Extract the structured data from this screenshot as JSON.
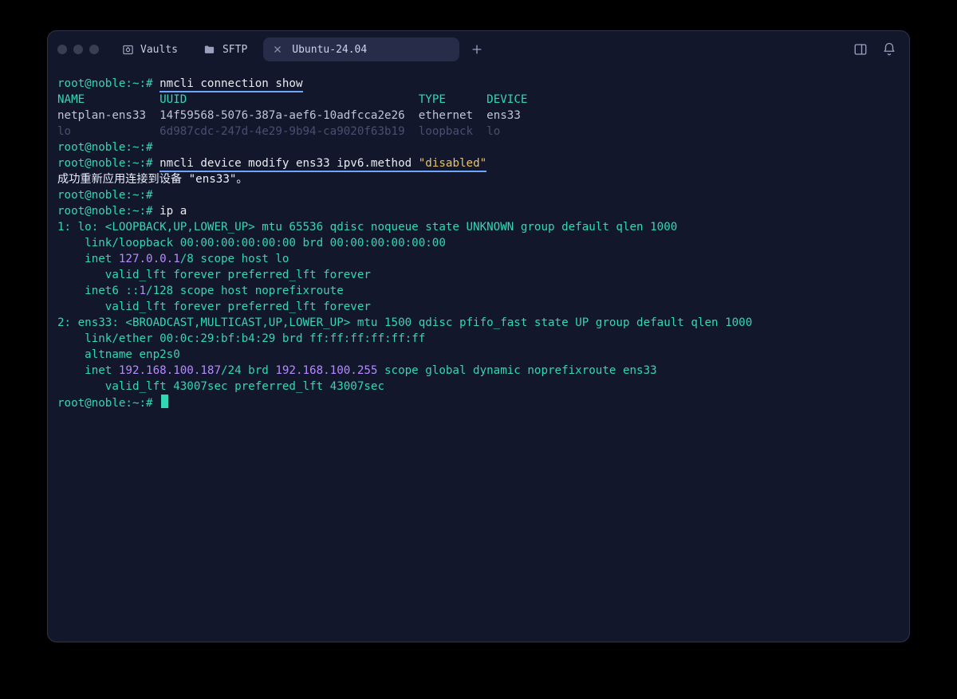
{
  "tabs": {
    "vaults": "Vaults",
    "sftp": "SFTP",
    "active": "Ubuntu-24.04"
  },
  "prompt": "root@noble:~",
  "hash": "#",
  "cmds": {
    "c1": "nmcli connection show",
    "c2": "nmcli device modify ens33 ipv6.method ",
    "c2q": "\"disabled\"",
    "c3": "ip a"
  },
  "table": {
    "h1": "NAME",
    "h2": "UUID",
    "h3": "TYPE",
    "h4": "DEVICE",
    "r1c1": "netplan-ens33",
    "r1c2": "14f59568-5076-387a-aef6-10adfcca2e26",
    "r1c3": "ethernet",
    "r1c4": "ens33",
    "r2c1": "lo",
    "r2c2": "6d987cdc-247d-4e29-9b94-ca9020f63b19",
    "r2c3": "loopback",
    "r2c4": "lo"
  },
  "msg_success": "成功重新应用连接到设备 \"ens33\"。",
  "ipa": {
    "l1a": "1: lo: <LOOPBACK,UP,LOWER_UP> mtu 65536 qdisc noqueue state UNKNOWN group default qlen 1000",
    "l2": "    link/loopback 00:00:00:00:00:00 brd 00:00:00:00:00:00",
    "l3a": "    inet ",
    "l3b": "127.0.0.1",
    "l3c": "/8 scope host lo",
    "l4": "       valid_lft forever preferred_lft forever",
    "l5a": "    inet6 ::",
    "l5b": "1",
    "l5c": "/128 scope host noprefixroute",
    "l6": "       valid_lft forever preferred_lft forever",
    "l7": "2: ens33: <BROADCAST,MULTICAST,UP,LOWER_UP> mtu 1500 qdisc pfifo_fast state UP group default qlen 1000",
    "l8": "    link/ether 00:0c:29:bf:b4:29 brd ff:ff:ff:ff:ff:ff",
    "l9": "    altname enp2s0",
    "l10a": "    inet ",
    "l10b": "192.168.100.187",
    "l10c": "/24 brd ",
    "l10d": "192.168.100.255",
    "l10e": " scope global dynamic noprefixroute ens33",
    "l11": "       valid_lft 43007sec preferred_lft 43007sec"
  }
}
